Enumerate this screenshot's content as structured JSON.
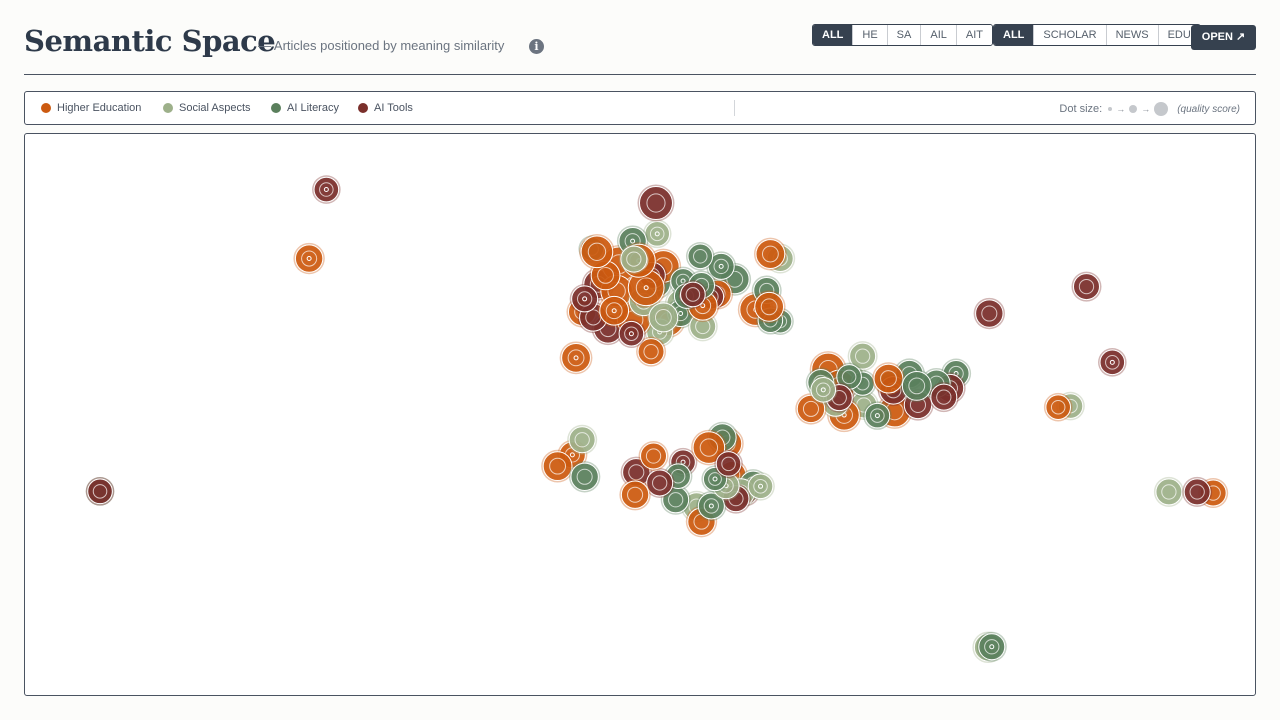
{
  "header": {
    "title": "Semantic Space",
    "subtitle": "— Articles positioned by meaning similarity",
    "info_icon": "info-icon",
    "topic_filter": [
      "ALL",
      "HE",
      "SA",
      "AIL",
      "AIT"
    ],
    "topic_active": "ALL",
    "source_filter": [
      "ALL",
      "SCHOLAR",
      "NEWS",
      "EDU"
    ],
    "source_active": "ALL",
    "open_label": "OPEN ↗"
  },
  "legend": {
    "items": [
      {
        "label": "Higher Education",
        "color": "#cc5a10"
      },
      {
        "label": "Social Aspects",
        "color": "#9db08a"
      },
      {
        "label": "AI Literacy",
        "color": "#5a7f5c"
      },
      {
        "label": "AI Tools",
        "color": "#7a2f2b"
      }
    ],
    "size_label": "Dot size:",
    "size_note": "(quality score)"
  },
  "chart_data": {
    "type": "scatter",
    "title": "",
    "xlabel": "",
    "ylabel": "",
    "xlim": [
      0,
      100
    ],
    "ylim": [
      0,
      100
    ],
    "grid": false,
    "legend_position": "top",
    "categories": [
      "Higher Education",
      "Social Aspects",
      "AI Literacy",
      "AI Tools"
    ],
    "series": [
      {
        "name": "Higher Education",
        "color": "#cc5a10",
        "points": [
          [
            23.1,
            77.8,
            0.55
          ],
          [
            46.5,
            79.0,
            0.7
          ],
          [
            48.3,
            76.8,
            0.8
          ],
          [
            49.9,
            77.4,
            0.75
          ],
          [
            47.2,
            74.8,
            0.6
          ],
          [
            51.9,
            76.4,
            0.7
          ],
          [
            50.5,
            72.6,
            0.85
          ],
          [
            48.1,
            72.0,
            0.7
          ],
          [
            45.3,
            68.3,
            0.55
          ],
          [
            47.9,
            68.5,
            0.6
          ],
          [
            49.5,
            66.9,
            0.75
          ],
          [
            52.3,
            66.7,
            0.65
          ],
          [
            55.1,
            69.4,
            0.6
          ],
          [
            56.3,
            71.5,
            0.55
          ],
          [
            60.5,
            69.2,
            0.6
          ],
          [
            59.4,
            68.7,
            0.7
          ],
          [
            50.9,
            61.2,
            0.5
          ],
          [
            60.6,
            78.6,
            0.6
          ],
          [
            44.8,
            60.1,
            0.6
          ],
          [
            65.3,
            58.0,
            0.75
          ],
          [
            63.9,
            51.0,
            0.55
          ],
          [
            66.6,
            49.9,
            0.65
          ],
          [
            70.7,
            50.6,
            0.7
          ],
          [
            70.2,
            56.4,
            0.6
          ],
          [
            66.2,
            55.1,
            0.7
          ],
          [
            84.0,
            51.3,
            0.45
          ],
          [
            43.3,
            40.8,
            0.6
          ],
          [
            44.5,
            42.8,
            0.5
          ],
          [
            51.1,
            42.6,
            0.5
          ],
          [
            55.6,
            44.1,
            0.7
          ],
          [
            57.1,
            44.8,
            0.6
          ],
          [
            49.6,
            35.7,
            0.55
          ],
          [
            55.0,
            30.9,
            0.55
          ],
          [
            57.5,
            39.2,
            0.55
          ],
          [
            96.6,
            36.0,
            0.5
          ]
        ]
      },
      {
        "name": "Social Aspects",
        "color": "#9db08a",
        "points": [
          [
            51.4,
            82.2,
            0.45
          ],
          [
            49.5,
            77.7,
            0.5
          ],
          [
            50.3,
            70.2,
            0.6
          ],
          [
            53.3,
            69.8,
            0.55
          ],
          [
            51.9,
            67.3,
            0.6
          ],
          [
            55.1,
            65.7,
            0.5
          ],
          [
            51.6,
            64.7,
            0.5
          ],
          [
            61.4,
            77.8,
            0.5
          ],
          [
            68.1,
            60.4,
            0.5
          ],
          [
            67.3,
            56.7,
            0.45
          ],
          [
            65.9,
            52.0,
            0.5
          ],
          [
            68.2,
            51.7,
            0.5
          ],
          [
            64.9,
            54.4,
            0.45
          ],
          [
            85.0,
            51.5,
            0.45
          ],
          [
            45.3,
            45.5,
            0.5
          ],
          [
            57.0,
            37.3,
            0.5
          ],
          [
            58.2,
            36.1,
            0.55
          ],
          [
            54.6,
            33.6,
            0.55
          ],
          [
            59.8,
            37.2,
            0.45
          ],
          [
            78.3,
            8.5,
            0.55
          ],
          [
            93.0,
            36.2,
            0.5
          ]
        ]
      },
      {
        "name": "AI Literacy",
        "color": "#5a7f5c",
        "points": [
          [
            49.4,
            80.9,
            0.55
          ],
          [
            46.1,
            79.5,
            0.4
          ],
          [
            54.9,
            78.2,
            0.45
          ],
          [
            56.6,
            76.4,
            0.5
          ],
          [
            51.3,
            73.4,
            0.6
          ],
          [
            55.0,
            73.0,
            0.5
          ],
          [
            53.5,
            73.8,
            0.45
          ],
          [
            57.7,
            74.1,
            0.6
          ],
          [
            60.3,
            72.1,
            0.5
          ],
          [
            53.3,
            68.0,
            0.5
          ],
          [
            53.8,
            71.1,
            0.45
          ],
          [
            60.6,
            66.8,
            0.45
          ],
          [
            61.4,
            66.6,
            0.4
          ],
          [
            64.7,
            55.7,
            0.5
          ],
          [
            67.0,
            56.7,
            0.45
          ],
          [
            70.4,
            55.4,
            0.5
          ],
          [
            72.5,
            55.1,
            0.6
          ],
          [
            71.9,
            57.2,
            0.55
          ],
          [
            75.7,
            57.3,
            0.5
          ],
          [
            74.1,
            55.5,
            0.55
          ],
          [
            68.1,
            55.5,
            0.4
          ],
          [
            69.3,
            49.8,
            0.45
          ],
          [
            45.5,
            38.9,
            0.55
          ],
          [
            56.7,
            45.9,
            0.55
          ],
          [
            56.1,
            38.5,
            0.4
          ],
          [
            53.1,
            39.0,
            0.45
          ],
          [
            52.9,
            34.8,
            0.5
          ],
          [
            55.8,
            33.7,
            0.5
          ],
          [
            59.2,
            37.6,
            0.5
          ],
          [
            6.1,
            36.3,
            0.45
          ],
          [
            78.6,
            8.6,
            0.5
          ]
        ]
      },
      {
        "name": "AI Tools",
        "color": "#7a2f2b",
        "points": [
          [
            24.5,
            90.1,
            0.45
          ],
          [
            51.3,
            87.7,
            0.75
          ],
          [
            46.6,
            73.2,
            0.6
          ],
          [
            45.5,
            70.6,
            0.5
          ],
          [
            46.2,
            67.3,
            0.55
          ],
          [
            47.4,
            65.3,
            0.6
          ],
          [
            49.3,
            64.4,
            0.45
          ],
          [
            51.0,
            74.8,
            0.5
          ],
          [
            54.3,
            71.4,
            0.45
          ],
          [
            55.8,
            71.0,
            0.45
          ],
          [
            65.1,
            53.8,
            0.45
          ],
          [
            66.2,
            53.0,
            0.5
          ],
          [
            70.6,
            54.3,
            0.55
          ],
          [
            72.6,
            51.7,
            0.55
          ],
          [
            74.7,
            53.1,
            0.5
          ],
          [
            75.2,
            54.7,
            0.55
          ],
          [
            49.7,
            39.7,
            0.55
          ],
          [
            51.6,
            37.8,
            0.5
          ],
          [
            53.5,
            41.5,
            0.45
          ],
          [
            57.2,
            41.2,
            0.45
          ],
          [
            57.8,
            35.0,
            0.5
          ],
          [
            58.6,
            36.2,
            0.45
          ],
          [
            78.4,
            68.0,
            0.55
          ],
          [
            86.3,
            72.8,
            0.5
          ],
          [
            88.4,
            59.3,
            0.45
          ],
          [
            95.3,
            36.2,
            0.5
          ],
          [
            6.1,
            36.3,
            0.45
          ]
        ]
      }
    ]
  }
}
